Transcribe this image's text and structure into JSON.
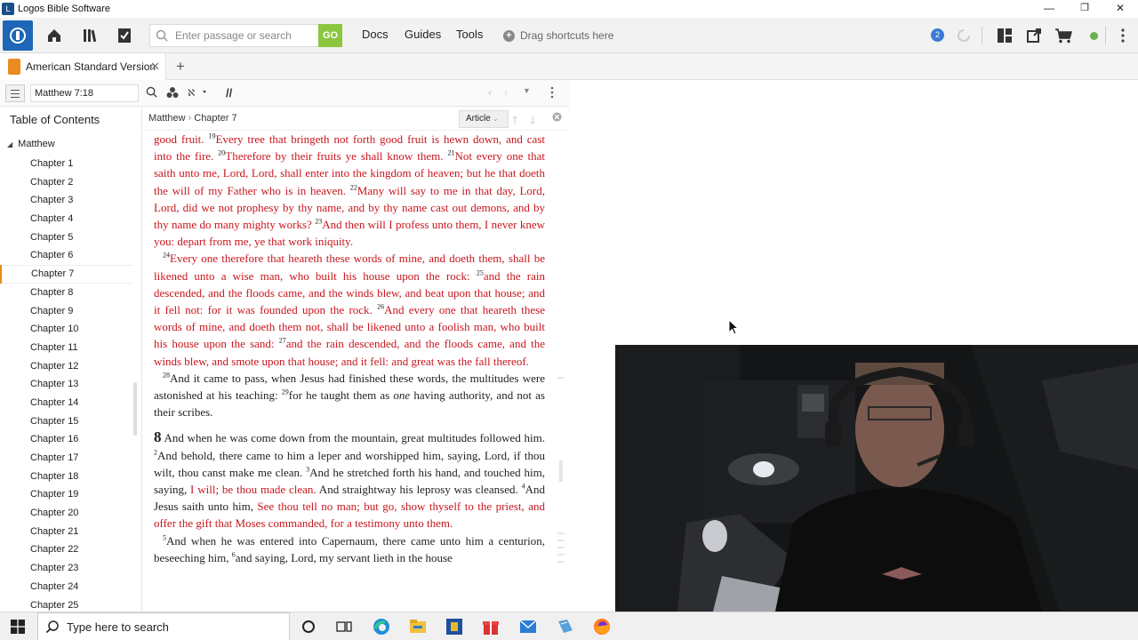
{
  "window": {
    "title": "Logos Bible Software",
    "minimize": "—",
    "restore": "❐",
    "close": "✕"
  },
  "toolbar": {
    "search_placeholder": "Enter passage or search",
    "go_label": "GO",
    "menu": [
      "Docs",
      "Guides",
      "Tools"
    ],
    "shortcuts_hint": "Drag shortcuts here",
    "notification_count": "2"
  },
  "tabs": [
    {
      "title": "American Standard Version",
      "close": "✕"
    }
  ],
  "tab_add": "+",
  "panel": {
    "reference": "Matthew 7:18",
    "parallel_icon": "//"
  },
  "toc": {
    "title": "Table of Contents",
    "book": "Matthew",
    "chapters": [
      "Chapter 1",
      "Chapter 2",
      "Chapter 3",
      "Chapter 4",
      "Chapter 5",
      "Chapter 6",
      "Chapter 7",
      "Chapter 8",
      "Chapter 9",
      "Chapter 10",
      "Chapter 11",
      "Chapter 12",
      "Chapter 13",
      "Chapter 14",
      "Chapter 15",
      "Chapter 16",
      "Chapter 17",
      "Chapter 18",
      "Chapter 19",
      "Chapter 20",
      "Chapter 21",
      "Chapter 22",
      "Chapter 23",
      "Chapter 24",
      "Chapter 25"
    ],
    "active_chapter": "Chapter 7"
  },
  "reader": {
    "breadcrumb": [
      "Matthew",
      "Chapter 7"
    ],
    "view_mode": "Article",
    "paragraphs": [
      {
        "segments": [
          {
            "t": "good fruit. ",
            "red": true
          },
          {
            "v": "19"
          },
          {
            "t": "Every tree that bringeth not forth good fruit is hewn down, and cast into the fire. ",
            "red": true
          },
          {
            "v": "20"
          },
          {
            "t": "Therefore by their fruits ye shall know them. ",
            "red": true
          },
          {
            "v": "21"
          },
          {
            "t": "Not every one that saith unto me, Lord, Lord, shall enter into the kingdom of heaven; but he that doeth the will of my Father who is in heaven. ",
            "red": true
          },
          {
            "v": "22"
          },
          {
            "t": "Many will say to me in that day, Lord, Lord, did we not prophesy by thy name, and by thy name cast out demons, and by thy name do many mighty works? ",
            "red": true
          },
          {
            "v": "23"
          },
          {
            "t": "And then will I profess unto them, I never knew you: depart from me, ye that work iniquity.",
            "red": true
          }
        ]
      },
      {
        "indent": true,
        "segments": [
          {
            "v": "24"
          },
          {
            "t": "Every one therefore that heareth these words of mine, and doeth them, shall be likened unto a wise man, who built his house upon the rock: ",
            "red": true
          },
          {
            "v": "25"
          },
          {
            "t": "and the rain descended, and the floods came, and the winds blew, and beat upon that house; and it fell not: for it was founded upon the rock. ",
            "red": true
          },
          {
            "v": "26"
          },
          {
            "t": "And every one that heareth these words of mine, and doeth them not, shall be likened unto a foolish man, who built his house upon the sand: ",
            "red": true
          },
          {
            "v": "27"
          },
          {
            "t": "and the rain descended, and the floods came, and the winds blew, and smote upon that house; and it fell: and great was the fall thereof.",
            "red": true
          }
        ]
      },
      {
        "indent": true,
        "segments": [
          {
            "v": "28"
          },
          {
            "t": "And it came to pass, when Jesus had finished these words, the multitudes were astonished at his teaching: "
          },
          {
            "v": "29"
          },
          {
            "t": "for he taught them as "
          },
          {
            "t": "one",
            "italic": true
          },
          {
            "t": " having authority, and not as their scribes."
          }
        ]
      },
      {
        "chapter": "8",
        "segments": [
          {
            "t": "And when he was come down from the mountain, great multitudes followed him. "
          },
          {
            "v": "2"
          },
          {
            "t": "And behold, there came to him a leper and worshipped him, saying, Lord, if thou wilt, thou canst make me clean. "
          },
          {
            "v": "3"
          },
          {
            "t": "And he stretched forth his hand, and touched him, saying, "
          },
          {
            "t": "I will; be thou made clean.",
            "red": true
          },
          {
            "t": " And straightway his leprosy was cleansed. "
          },
          {
            "v": "4"
          },
          {
            "t": "And Jesus saith unto him, "
          },
          {
            "t": "See thou tell no man; but go, show thyself to the priest, and offer the gift that Moses commanded, for a testimony unto them.",
            "red": true
          }
        ]
      },
      {
        "indent": true,
        "segments": [
          {
            "v": "5"
          },
          {
            "t": "And when he was entered into Capernaum, there came unto him a centurion, beseeching him, "
          },
          {
            "v": "6"
          },
          {
            "t": "and saying, Lord, my servant lieth in the house"
          }
        ]
      }
    ]
  },
  "taskbar": {
    "search_placeholder": "Type here to search"
  },
  "colors": {
    "accent_blue": "#1d67b6",
    "go_green": "#8cc63e",
    "words_of_christ_red": "#c8161d",
    "tab_orange": "#e98b1f"
  }
}
